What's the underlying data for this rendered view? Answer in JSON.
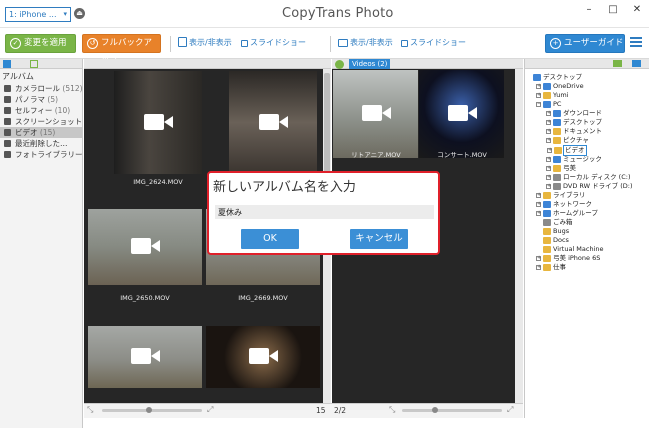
{
  "titlebar": {
    "device": "1: iPhone ...",
    "app_title": "CopyTrans Photo",
    "minimize": "–",
    "maximize": "□",
    "close": "✕"
  },
  "toolbar": {
    "apply_label": "変更を適用",
    "backup_label": "フルバックアップ",
    "toggle1_label": "表示/非表示",
    "slideshow1_label": "スライドショー",
    "toggle2_label": "表示/非表示",
    "slideshow2_label": "スライドショー",
    "guide_label": "ユーザーガイド"
  },
  "sidebar": {
    "title": "アルバム",
    "items": [
      {
        "label": "カメラロール",
        "count": "(512)"
      },
      {
        "label": "パノラマ",
        "count": "(5)"
      },
      {
        "label": "セルフィー",
        "count": "(10)"
      },
      {
        "label": "スクリーンショット",
        "count": ""
      },
      {
        "label": "ビデオ",
        "count": "(15)"
      },
      {
        "label": "最近削除した…",
        "count": ""
      },
      {
        "label": "フォトライブラリー…",
        "count": ""
      }
    ]
  },
  "pane_left": {
    "thumbnails": [
      {
        "caption": "IMG_2624.MOV"
      },
      {
        "caption": ""
      },
      {
        "caption": "IMG_2650.MOV"
      },
      {
        "caption": "IMG_2669.MOV"
      },
      {
        "caption": ""
      },
      {
        "caption": ""
      }
    ],
    "count": "15"
  },
  "pane_right": {
    "tab_label": "Videos (2)",
    "thumbnails": [
      {
        "caption": "リトアニア.MOV"
      },
      {
        "caption": "コンサート.MOV"
      }
    ],
    "count": "2/2"
  },
  "tree": {
    "items": [
      {
        "label": "デスクトップ"
      },
      {
        "label": "OneDrive"
      },
      {
        "label": "Yumi"
      },
      {
        "label": "PC"
      },
      {
        "label": "ダウンロード"
      },
      {
        "label": "デスクトップ"
      },
      {
        "label": "ドキュメント"
      },
      {
        "label": "ピクチャ"
      },
      {
        "label": "ビデオ"
      },
      {
        "label": "ミュージック"
      },
      {
        "label": "弓美"
      },
      {
        "label": "ローカル ディスク (C:)"
      },
      {
        "label": "DVD RW ドライブ (D:)"
      },
      {
        "label": "ライブラリ"
      },
      {
        "label": "ネットワーク"
      },
      {
        "label": "ホームグループ"
      },
      {
        "label": "ごみ箱"
      },
      {
        "label": "Bugs"
      },
      {
        "label": "Docs"
      },
      {
        "label": "Virtual Machine"
      },
      {
        "label": "弓美 iPhone 6S"
      },
      {
        "label": "仕事"
      }
    ]
  },
  "dialog": {
    "title": "新しいアルバム名を入力",
    "input_value": "夏休み",
    "ok_label": "OK",
    "cancel_label": "キャンセル"
  },
  "colors": {
    "accent_blue": "#2f88d2",
    "apply_green": "#7ab547",
    "backup_orange": "#e8822a",
    "dialog_border": "#e0202a"
  }
}
